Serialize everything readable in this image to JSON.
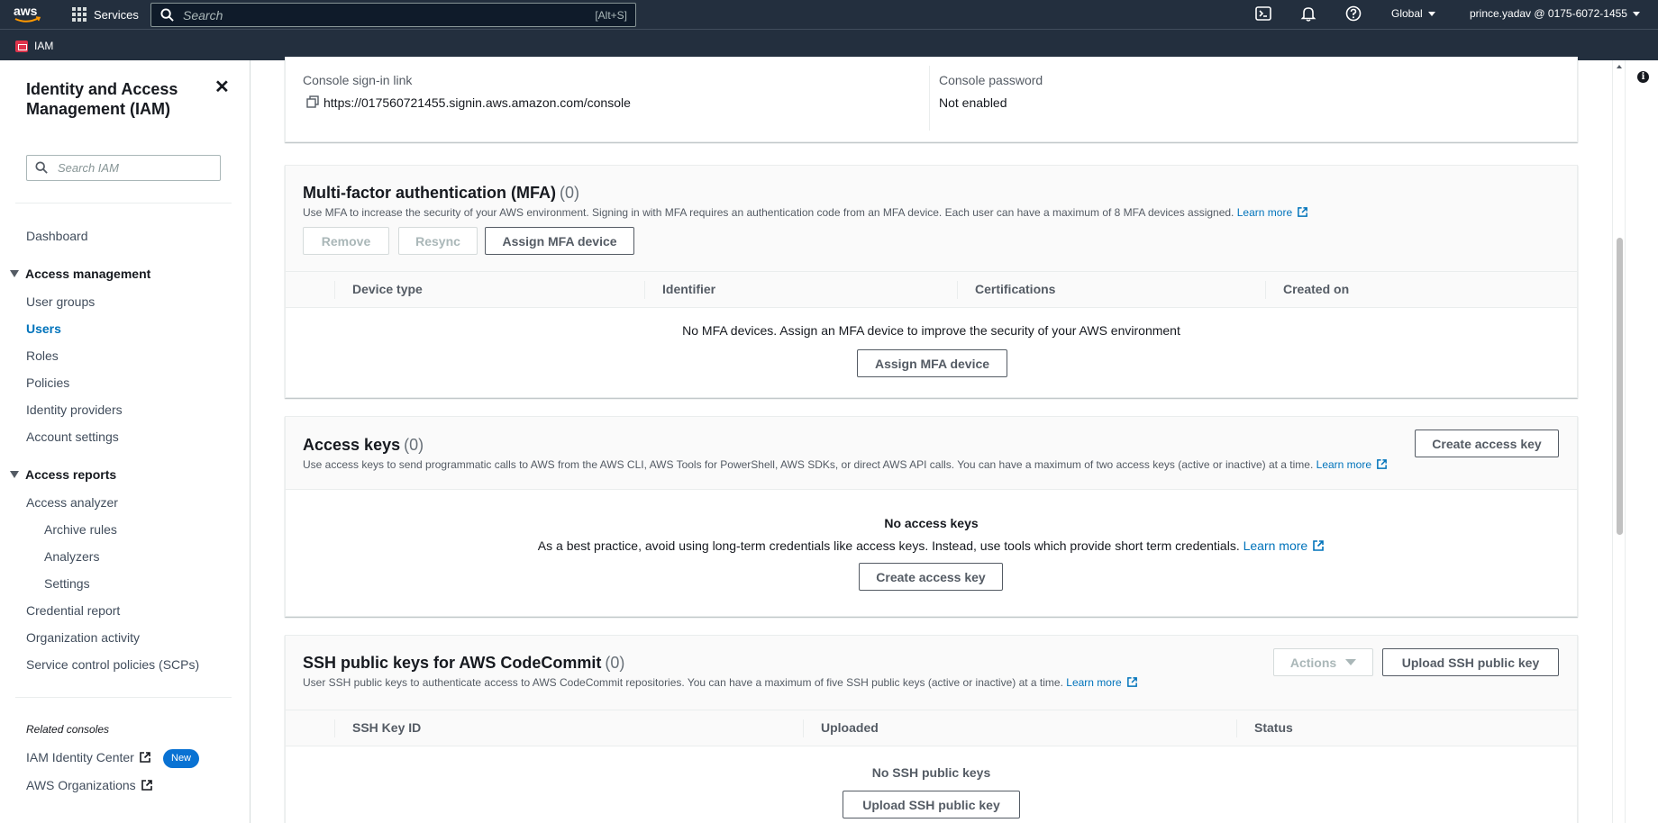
{
  "topnav": {
    "services_label": "Services",
    "search_placeholder": "Search",
    "search_shortcut": "[Alt+S]",
    "region": "Global",
    "account": "prince.yadav @ 0175-6072-1455",
    "icons": [
      "cloudshell-icon",
      "bell-icon",
      "help-icon"
    ]
  },
  "servicebar": {
    "service": "IAM"
  },
  "sidebar": {
    "title": "Identity and Access Management (IAM)",
    "search_placeholder": "Search IAM",
    "dashboard": "Dashboard",
    "access_management": {
      "label": "Access management",
      "items": [
        "User groups",
        "Users",
        "Roles",
        "Policies",
        "Identity providers",
        "Account settings"
      ],
      "active": "Users"
    },
    "access_reports": {
      "label": "Access reports",
      "items": [
        "Access analyzer",
        "Archive rules",
        "Analyzers",
        "Settings",
        "Credential report",
        "Organization activity",
        "Service control policies (SCPs)"
      ]
    },
    "related_consoles": {
      "label": "Related consoles",
      "items": [
        "IAM Identity Center",
        "AWS Organizations"
      ],
      "new_badge": "New"
    }
  },
  "console_access": {
    "signin_label": "Console sign-in link",
    "signin_url": "https://017560721455.signin.aws.amazon.com/console",
    "password_label": "Console password",
    "password_value": "Not enabled"
  },
  "mfa": {
    "title": "Multi-factor authentication (MFA)",
    "count": "(0)",
    "description": "Use MFA to increase the security of your AWS environment. Signing in with MFA requires an authentication code from an MFA device. Each user can have a maximum of 8 MFA devices assigned.",
    "learn_more": "Learn more",
    "buttons": {
      "remove": "Remove",
      "resync": "Resync",
      "assign": "Assign MFA device"
    },
    "columns": [
      "Device type",
      "Identifier",
      "Certifications",
      "Created on"
    ],
    "empty_text": "No MFA devices. Assign an MFA device to improve the security of your AWS environment",
    "empty_button": "Assign MFA device"
  },
  "access_keys": {
    "title": "Access keys",
    "count": "(0)",
    "description": "Use access keys to send programmatic calls to AWS from the AWS CLI, AWS Tools for PowerShell, AWS SDKs, or direct AWS API calls. You can have a maximum of two access keys (active or inactive) at a time.",
    "learn_more": "Learn more",
    "create_button": "Create access key",
    "empty_title": "No access keys",
    "empty_desc": "As a best practice, avoid using long-term credentials like access keys. Instead, use tools which provide short term credentials.",
    "empty_learn_more": "Learn more",
    "empty_button": "Create access key"
  },
  "ssh_keys": {
    "title": "SSH public keys for AWS CodeCommit",
    "count": "(0)",
    "description": "User SSH public keys to authenticate access to AWS CodeCommit repositories. You can have a maximum of five SSH public keys (active or inactive) at a time.",
    "learn_more": "Learn more",
    "actions_button": "Actions",
    "upload_button": "Upload SSH public key",
    "columns": [
      "SSH Key ID",
      "Uploaded",
      "Status"
    ],
    "empty_text": "No SSH public keys",
    "empty_button": "Upload SSH public key"
  }
}
